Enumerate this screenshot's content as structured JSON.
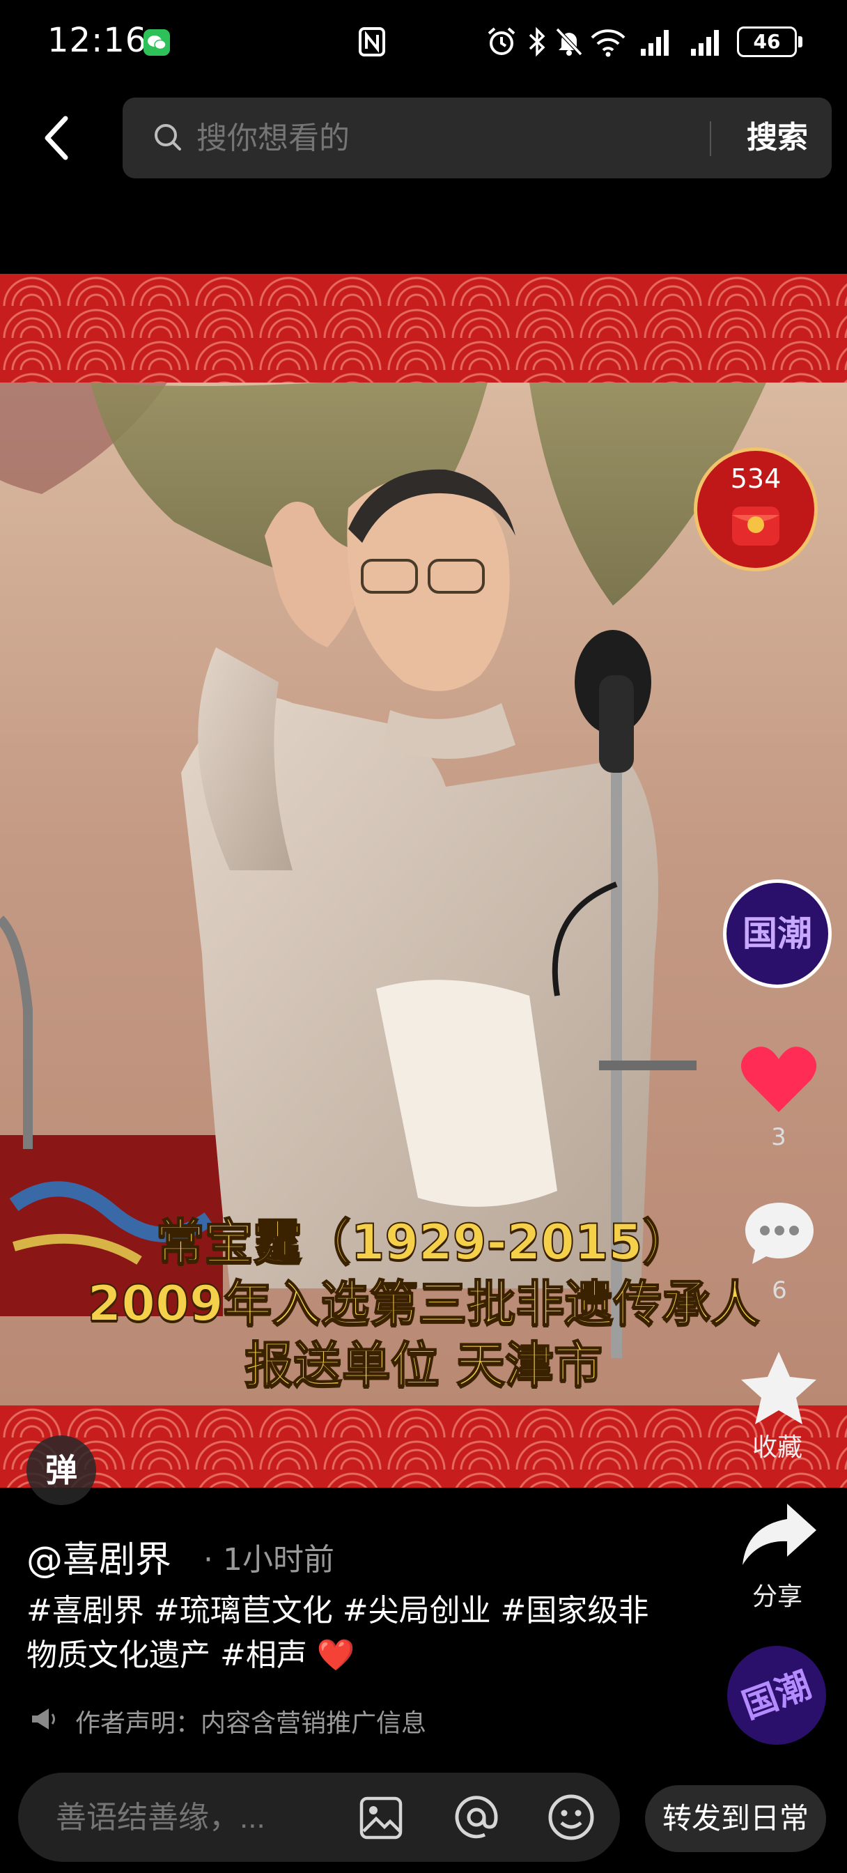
{
  "status_bar": {
    "time": "12:16",
    "battery": "46",
    "icons": [
      "wechat-icon",
      "nfc-icon",
      "alarm-icon",
      "bluetooth-icon",
      "mute-icon",
      "wifi-6-icon",
      "signal-icon",
      "signal-icon"
    ]
  },
  "search": {
    "placeholder": "搜你想看的",
    "button_label": "搜索"
  },
  "video": {
    "overlay_lines": [
      "常宝霆（1929-2015）",
      "2009年入选第三批非遗传承人",
      "报送单位 天津市"
    ],
    "overlay_color": "#f5d04a",
    "band_color": "#c71d1d"
  },
  "right_rail": {
    "red_packet_count": "534",
    "badge_label": "国潮",
    "likes": "3",
    "comments": "6",
    "favorite_label": "收藏",
    "share_label": "分享",
    "badge2_label": "国潮",
    "like_color": "#ff2d55"
  },
  "danmaku": {
    "label": "弹"
  },
  "post": {
    "author": "@喜剧界",
    "time": "· 1小时前",
    "description": "#喜剧界 #琉璃苣文化 #尖局创业 #国家级非物质文化遗产 #相声 ❤️",
    "disclaimer": "作者声明：内容含营销推广信息"
  },
  "bottom_bar": {
    "comment_placeholder": "善语结善缘，...",
    "repost_label": "转发到日常"
  }
}
